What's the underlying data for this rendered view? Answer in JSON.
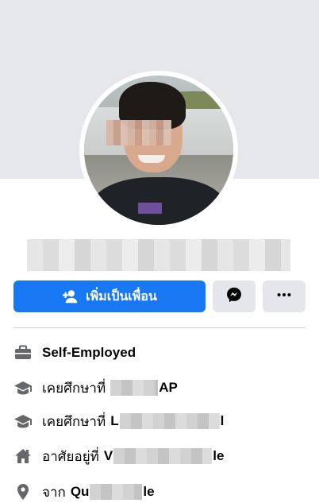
{
  "profile": {
    "add_friend_label": "เพิ่มเป็นเพื่อน"
  },
  "colors": {
    "primary": "#1877f2",
    "secondary_button": "#e4e6eb",
    "cover": "#e5e7eb"
  },
  "icons": {
    "add_friend": "person-plus-icon",
    "messenger": "messenger-icon",
    "more": "more-dots-icon",
    "work": "briefcase-icon",
    "education": "graduation-cap-icon",
    "home": "house-icon",
    "location": "location-pin-icon"
  },
  "intro": {
    "work": "Self-Employed",
    "education_1_prefix": "เคยศึกษาที่",
    "education_1_tail": "AP",
    "education_2_prefix": "เคยศึกษาที่",
    "education_2_head": "L",
    "education_2_tail": "l",
    "lives_prefix": "อาศัยอยู่ที่",
    "lives_head": "V",
    "lives_tail": "le",
    "from_prefix": "จาก",
    "from_head": "Qu",
    "from_tail": "le"
  }
}
